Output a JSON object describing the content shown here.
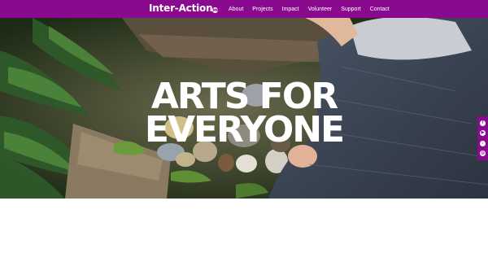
{
  "brand": {
    "name": "Inter-Action",
    "badge": "MK"
  },
  "nav": {
    "items": [
      {
        "label": "About"
      },
      {
        "label": "Projects"
      },
      {
        "label": "Impact"
      },
      {
        "label": "Volunteer"
      },
      {
        "label": "Support"
      },
      {
        "label": "Contact"
      }
    ]
  },
  "hero": {
    "line1": "ARTS FOR",
    "line2": "EVERYONE"
  },
  "social": {
    "icons": [
      {
        "name": "facebook-icon",
        "glyph": "f"
      },
      {
        "name": "youtube-icon",
        "glyph": "▶"
      },
      {
        "name": "tiktok-icon",
        "glyph": "♪"
      },
      {
        "name": "instagram-icon",
        "glyph": "◎"
      }
    ]
  },
  "colors": {
    "brand": "#8a0a8f",
    "text": "#ffffff"
  }
}
